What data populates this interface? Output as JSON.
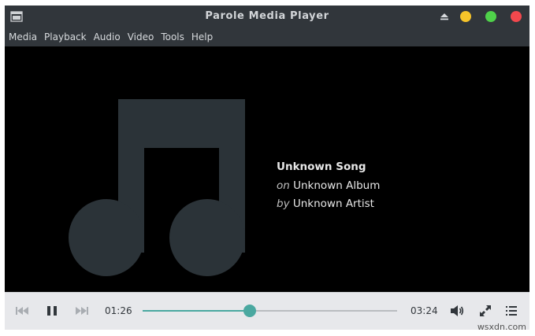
{
  "window": {
    "title": "Parole Media Player",
    "colors": {
      "titlebar": "#31363b",
      "minimize": "#f6c42a",
      "maximize": "#4fd14a",
      "close": "#f2484d"
    }
  },
  "menu": {
    "items": [
      "Media",
      "Playback",
      "Audio",
      "Video",
      "Tools",
      "Help"
    ]
  },
  "now_playing": {
    "title": "Unknown Song",
    "album_prefix": "on",
    "album": "Unknown Album",
    "artist_prefix": "by",
    "artist": "Unknown Artist",
    "art_icon": "music-note-icon"
  },
  "playback": {
    "elapsed": "01:26",
    "duration": "03:24",
    "progress": 0.42,
    "state": "playing",
    "accent": "#4aa8a0"
  },
  "controls": {
    "icons": [
      "previous-icon",
      "pause-icon",
      "next-icon",
      "volume-icon",
      "fullscreen-icon",
      "playlist-icon"
    ]
  },
  "watermark": "wsxdn.com"
}
